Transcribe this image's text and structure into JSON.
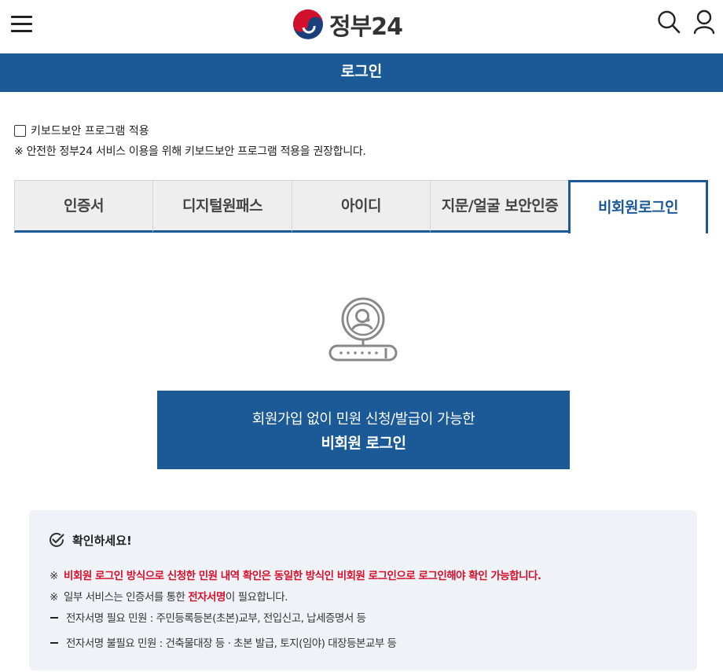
{
  "header": {
    "menu_icon": "hamburger-menu-icon",
    "logo_text": "정부24",
    "search_icon": "search-icon",
    "user_icon": "user-icon"
  },
  "titlebar": {
    "title": "로그인"
  },
  "keyboard_security": {
    "checkbox_label": "키보드보안 프로그램 적용",
    "checked": false,
    "note": "※ 안전한 정부24 서비스 이용을 위해 키보드보안 프로그램 적용을 권장합니다."
  },
  "tabs": [
    {
      "label": "인증서",
      "active": false
    },
    {
      "label": "디지털원패스",
      "active": false
    },
    {
      "label": "아이디",
      "active": false
    },
    {
      "label": "지문/얼굴 보안인증",
      "active": false
    },
    {
      "label": "비회원로그인",
      "active": true
    }
  ],
  "nonmember": {
    "illustration_icon": "user-keyboard-icon",
    "button_line1": "회원가입 없이 민원 신청/발급이 가능한",
    "button_line2": "비회원 로그인"
  },
  "notice": {
    "icon": "check-circle-icon",
    "title": "확인하세요!",
    "mark": "※",
    "line1": "비회원 로그인 방식으로 신청한 민원 내역 확인은 동일한 방식인 비회원 로그인으로 로그인해야 확인 가능합니다.",
    "line2_pre": "일부 서비스는 인증서를 통한 ",
    "line2_em": "전자서명",
    "line2_post": "이 필요합니다.",
    "line3": "전자서명 필요 민원 : 주민등록등본(초본)교부, 전입신고, 납세증명서 등",
    "line4": "전자서명 불필요 민원 : 건축물대장 등 · 초본 발급, 토지(임야) 대장등본교부 등"
  },
  "colors": {
    "primary": "#1b5a96",
    "alert_red": "#d4112c",
    "notice_bg": "#eff3f8"
  }
}
